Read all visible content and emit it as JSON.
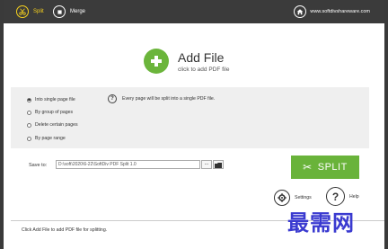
{
  "toolbar": {
    "split_label": "Split",
    "merge_label": "Merge",
    "website": "www.softdivshareware.com"
  },
  "add_file": {
    "title": "Add File",
    "subtitle": "click to add PDF file"
  },
  "options": {
    "items": [
      {
        "label": "Into single page file",
        "selected": true
      },
      {
        "label": "By group of pages",
        "selected": false
      },
      {
        "label": "Delete certain pages",
        "selected": false
      },
      {
        "label": "By page range",
        "selected": false
      }
    ],
    "help_text": "Every page will be split into a single PDF file."
  },
  "save": {
    "label": "Save to:",
    "path": "D:\\soft\\2020\\6-22\\SoftDiv PDF Split 1.0",
    "browse_label": "..."
  },
  "split_button": {
    "label": "SPLIT"
  },
  "settings": {
    "label": "Settings"
  },
  "help": {
    "label": "Help"
  },
  "status": {
    "text": "Click Add File to add PDF file for splitting."
  },
  "watermark": {
    "text": "最需网"
  },
  "colors": {
    "toolbar_bg": "#3b3b3b",
    "accent_yellow": "#f7d21e",
    "green": "#69b33a",
    "watermark": "#3a3ad0"
  }
}
